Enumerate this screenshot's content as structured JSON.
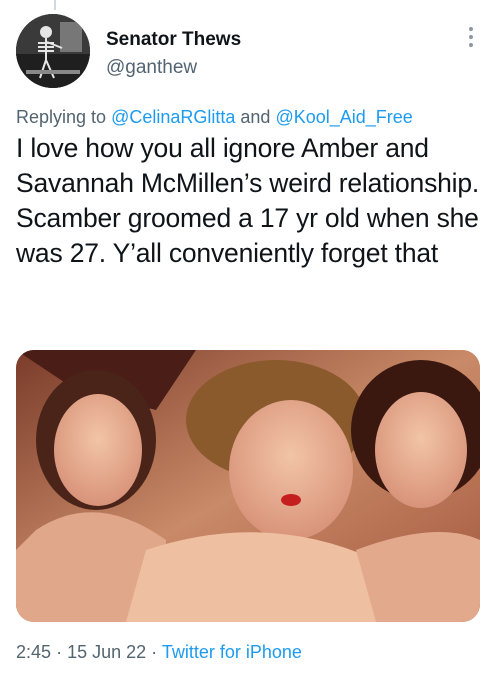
{
  "author": {
    "name": "Senator Thews",
    "handle": "@ganthew"
  },
  "reply": {
    "prefix": "Replying to",
    "mention1": "@CelinaRGlitta",
    "connector": "and",
    "mention2": "@Kool_Aid_Free"
  },
  "tweet": {
    "text": "I love how you all ignore Amber and Savannah McMillen’s weird relationship. Scamber groomed a 17 yr old when she was 27. Y’all conveniently forget that"
  },
  "meta": {
    "time": "2:45",
    "sep1": "·",
    "date": "15 Jun 22",
    "sep2": "·",
    "source": "Twitter for iPhone"
  },
  "icons": {
    "more": "more-vertical-icon"
  },
  "colors": {
    "link": "#1d9bf0",
    "secondary": "#536471",
    "text": "#0f1419"
  }
}
